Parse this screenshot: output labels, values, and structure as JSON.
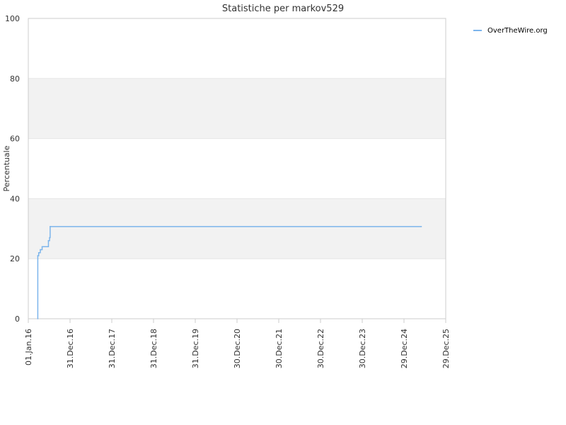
{
  "chart_data": {
    "type": "line",
    "title": "Statistiche per markov529",
    "xlabel": "",
    "ylabel": "Percentuale",
    "ylim": [
      0,
      100
    ],
    "yticks": [
      0,
      20,
      40,
      60,
      80,
      100
    ],
    "xlim": [
      "2016-01-01",
      "2025-12-29"
    ],
    "xticks": [
      {
        "date": "2016-01-01",
        "label": "01.Jan.16"
      },
      {
        "date": "2016-12-31",
        "label": "31.Dec.16"
      },
      {
        "date": "2017-12-31",
        "label": "31.Dec.17"
      },
      {
        "date": "2018-12-31",
        "label": "31.Dec.18"
      },
      {
        "date": "2019-12-31",
        "label": "31.Dec.19"
      },
      {
        "date": "2020-12-30",
        "label": "30.Dec.20"
      },
      {
        "date": "2021-12-30",
        "label": "30.Dec.21"
      },
      {
        "date": "2022-12-30",
        "label": "30.Dec.22"
      },
      {
        "date": "2023-12-30",
        "label": "30.Dec.23"
      },
      {
        "date": "2024-12-29",
        "label": "29.Dec.24"
      },
      {
        "date": "2025-12-29",
        "label": "29.Dec.25"
      }
    ],
    "grid": true,
    "alternating_bands": true,
    "legend_position": "top-right",
    "series": [
      {
        "name": "OverTheWire.org",
        "color": "#7cb5ec",
        "step": true,
        "points": [
          {
            "date": "2016-03-24",
            "y": 0
          },
          {
            "date": "2016-03-24",
            "y": 21
          },
          {
            "date": "2016-04-01",
            "y": 22
          },
          {
            "date": "2016-04-15",
            "y": 23
          },
          {
            "date": "2016-05-01",
            "y": 24
          },
          {
            "date": "2016-06-20",
            "y": 24
          },
          {
            "date": "2016-06-25",
            "y": 26
          },
          {
            "date": "2016-07-05",
            "y": 27
          },
          {
            "date": "2016-07-10",
            "y": 30.7
          },
          {
            "date": "2025-05-30",
            "y": 30.7
          }
        ]
      }
    ]
  },
  "colors": {
    "band": "#f2f2f2",
    "grid": "#e6e6e6",
    "axis": "#cccccc",
    "text": "#333333"
  }
}
